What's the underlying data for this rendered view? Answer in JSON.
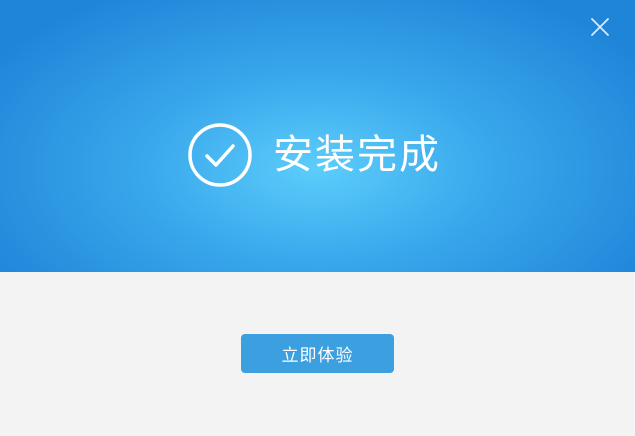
{
  "dialog": {
    "status_text": "安装完成",
    "status_icon": "check-circle-icon",
    "close_icon": "close-icon",
    "primary_button_label": "立即体验"
  },
  "colors": {
    "banner_center": "#5ccdfb",
    "banner_edge": "#1f85d9",
    "footer_background": "#f4f3f4",
    "button_background": "#3b9fe0",
    "text_on_blue": "#ffffff"
  }
}
